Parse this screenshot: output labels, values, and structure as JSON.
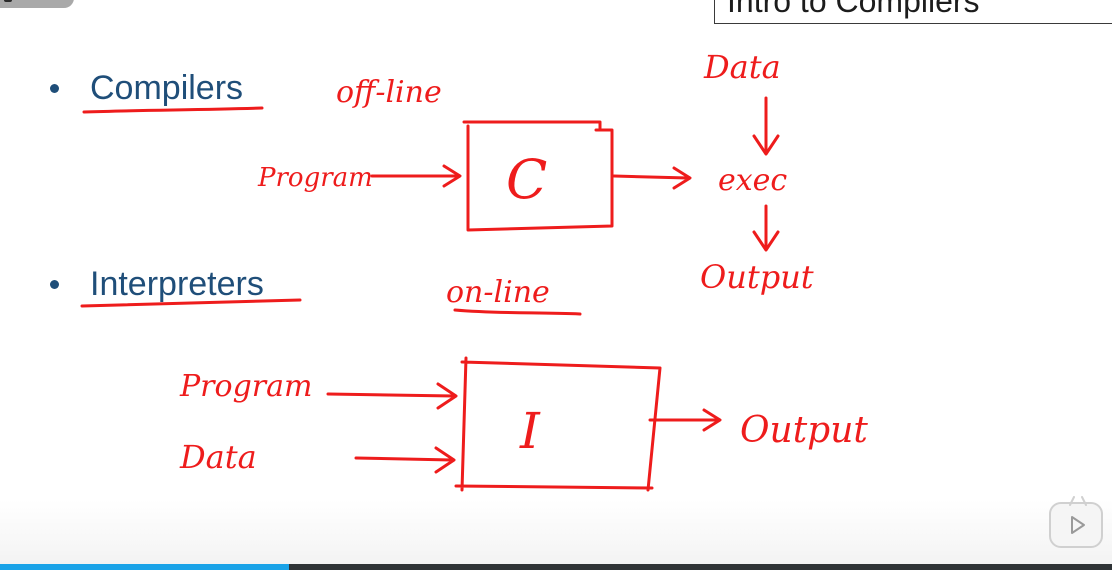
{
  "slide": {
    "title": "Intro to Compilers",
    "bullets": [
      {
        "label": "Compilers"
      },
      {
        "label": "Interpreters"
      }
    ]
  },
  "annotations": {
    "offline": "off-line",
    "online": "on-line",
    "compiler_input": "Program",
    "compiler_box": "C",
    "exec": "exec",
    "compiler_data": "Data",
    "compiler_output": "Output",
    "interp_program": "Program",
    "interp_data": "Data",
    "interp_box": "I",
    "interp_output": "Output"
  },
  "player": {
    "progress_fraction": 0.26,
    "play_icon": "play-icon"
  },
  "colors": {
    "ink": "#ee1c1c",
    "bullet_text": "#1f4e79",
    "progress": "#1aa3e8"
  }
}
